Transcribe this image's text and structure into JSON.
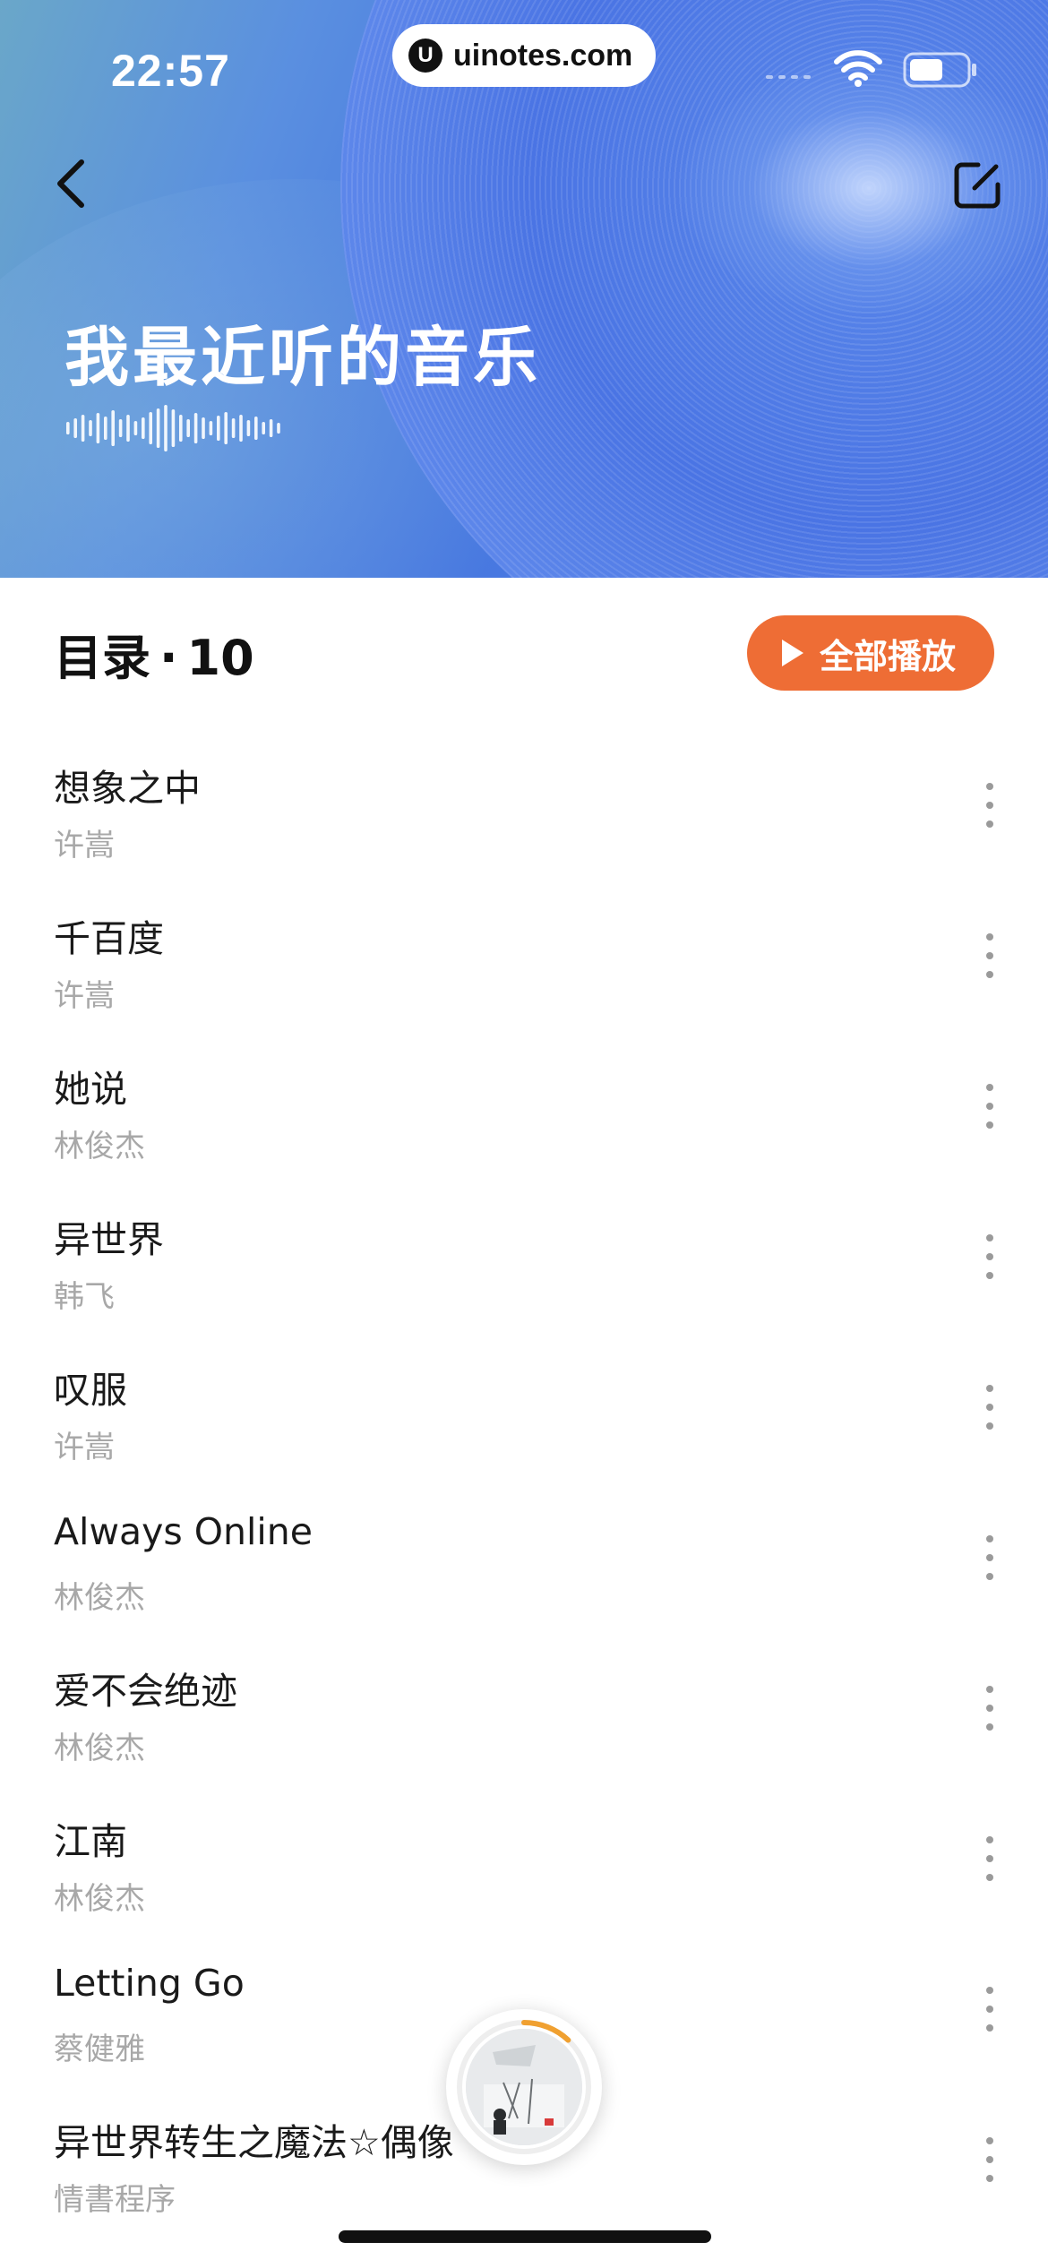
{
  "status_bar": {
    "time": "22:57",
    "url": "uinotes.com",
    "url_logo": "U"
  },
  "header": {
    "back_icon": "chevron-left-icon",
    "edit_icon": "edit-square-icon",
    "title": "我最近听的音乐"
  },
  "list": {
    "label": "目录",
    "separator": "·",
    "count": "10",
    "play_all_label": "全部播放",
    "play_all_color": "#ee6d35"
  },
  "songs": [
    {
      "title": "想象之中",
      "artist": "许嵩"
    },
    {
      "title": "千百度",
      "artist": "许嵩"
    },
    {
      "title": "她说",
      "artist": "林俊杰"
    },
    {
      "title": "异世界",
      "artist": "韩飞"
    },
    {
      "title": "叹服",
      "artist": "许嵩"
    },
    {
      "title": "Always Online",
      "artist": "林俊杰"
    },
    {
      "title": "爱不会绝迹",
      "artist": "林俊杰"
    },
    {
      "title": "江南",
      "artist": "林俊杰"
    },
    {
      "title": "Letting Go",
      "artist": "蔡健雅"
    },
    {
      "title": "异世界转生之魔法☆偶像",
      "artist": "情書程序"
    }
  ],
  "mini_player": {
    "progress_fraction": 0.12,
    "progress_color": "#f0a030"
  }
}
